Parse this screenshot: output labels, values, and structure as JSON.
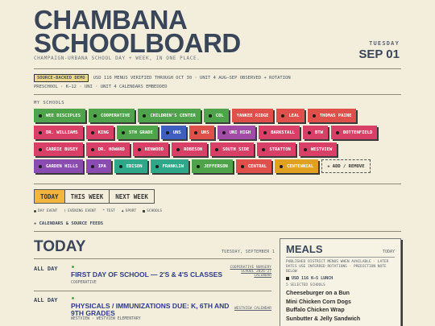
{
  "header": {
    "title_line1": "CHAMBANA",
    "title_line2": "SCHOOLBOARD",
    "subtitle": "CHAMPAIGN-URBANA SCHOOL DAY + WEEK, IN ONE PLACE.",
    "weekday": "TUESDAY",
    "date": "SEP 01"
  },
  "notice": {
    "badge": "SOURCE-BACKED DEMO",
    "text": "USD 116 MENUS VERIFIED THROUGH OCT 30 · UNIT 4 AUG–SEP OBSERVED + ROTATION",
    "scope": "PRESCHOOL · K–12 · UNI · UNIT 4 CALENDARS EMBEDDED"
  },
  "schools": {
    "label": "MY SCHOOLS",
    "rows": [
      [
        {
          "name": "WEE DISCIPLES",
          "color": "#4fa34a",
          "dot": true
        },
        {
          "name": "COOPERATIVE",
          "color": "#4fa34a",
          "dot": true
        },
        {
          "name": "CHILDREN'S CENTER",
          "color": "#4fa34a",
          "dot": true
        },
        {
          "name": "COL",
          "color": "#4fa34a",
          "dot": true
        },
        {
          "name": "YANKEE RIDGE",
          "color": "#e0504a",
          "dot": false
        },
        {
          "name": "LEAL",
          "color": "#e0504a",
          "dot": true
        },
        {
          "name": "THOMAS PAINE",
          "color": "#e0504a",
          "dot": true
        }
      ],
      [
        {
          "name": "DR. WILLIAMS",
          "color": "#d94068",
          "dot": true
        },
        {
          "name": "KING",
          "color": "#d94068",
          "dot": true
        },
        {
          "name": "5TH GRADE",
          "color": "#4fa34a",
          "dot": true
        },
        {
          "name": "UNS",
          "color": "#3f5fc0",
          "dot": true
        },
        {
          "name": "UNS",
          "color": "#e0504a",
          "dot": true
        },
        {
          "name": "UNI HIGH",
          "color": "#a24ba8",
          "dot": true
        },
        {
          "name": "BARKSTALL",
          "color": "#d94068",
          "dot": true
        },
        {
          "name": "BTW",
          "color": "#d94068",
          "dot": true
        },
        {
          "name": "BOTTENFIELD",
          "color": "#d94068",
          "dot": true
        }
      ],
      [
        {
          "name": "CARRIE BUSEY",
          "color": "#d94068",
          "dot": true
        },
        {
          "name": "DR. HOWARD",
          "color": "#d94068",
          "dot": true
        },
        {
          "name": "KENWOOD",
          "color": "#d94068",
          "dot": true
        },
        {
          "name": "ROBESON",
          "color": "#d94068",
          "dot": true
        },
        {
          "name": "SOUTH SIDE",
          "color": "#d94068",
          "dot": true
        },
        {
          "name": "STRATTON",
          "color": "#d94068",
          "dot": true
        },
        {
          "name": "WESTVIEW",
          "color": "#d94068",
          "dot": true
        }
      ],
      [
        {
          "name": "GARDEN HILLS",
          "color": "#8a4cb0",
          "dot": true
        },
        {
          "name": "IPA",
          "color": "#8a4cb0",
          "dot": true
        },
        {
          "name": "EDISON",
          "color": "#2fa88a",
          "dot": true
        },
        {
          "name": "FRANKLIN",
          "color": "#2fa88a",
          "dot": true
        },
        {
          "name": "JEFFERSON",
          "color": "#4fa34a",
          "dot": true
        },
        {
          "name": "CENTRAL",
          "color": "#e0504a",
          "dot": true
        },
        {
          "name": "CENTENNIAL",
          "color": "#e0a020",
          "dot": true
        }
      ]
    ],
    "add_label": "+ ADD / REMOVE"
  },
  "tabs": [
    {
      "label": "TODAY",
      "active": true
    },
    {
      "label": "THIS WEEK",
      "active": false
    },
    {
      "label": "NEXT WEEK",
      "active": false
    }
  ],
  "legend": {
    "day_event": "DAY EVENT",
    "evening_event": "EVENING EVENT",
    "test": "TEST",
    "sport": "SPORT",
    "schools": "SCHOOLS"
  },
  "calendars_link": "CALENDARS & SOURCE FEEDS",
  "today": {
    "heading": "TODAY",
    "date": "TUESDAY, SEPTEMBER 1",
    "events": [
      {
        "time": "ALL DAY",
        "title": "FIRST DAY OF SCHOOL — 2'S & 4'S CLASSES",
        "school": "COOPERATIVE",
        "source_line1": "COOPERATIVE NURSERY",
        "source_line2": "SCHOOL 2026-27",
        "source_line3": "CALENDAR"
      },
      {
        "time": "ALL DAY",
        "title": "PHYSICALS / IMMUNIZATIONS DUE: K, 6TH AND 9TH GRADES",
        "school": "WESTVIEW · WESTVIEW ELEMENTARY",
        "source_line1": "WESTVIEW CALENDAR"
      }
    ]
  },
  "meals": {
    "heading": "MEALS",
    "tag": "TODAY",
    "note": "PUBLISHED DISTRICT MENUS WHEN AVAILABLE · LATER DATES USE INFERRED ROTATIONS · PREDICTION NOTE BELOW",
    "lunch_label": "USD 116 K–5 LUNCH",
    "selected": "5 SELECTED SCHOOLS",
    "items": [
      "Cheeseburger on a Bun",
      "Mini Chicken Corn Dogs",
      "Buffalo Chicken Wrap",
      "Sunbutter & Jelly Sandwich"
    ]
  }
}
